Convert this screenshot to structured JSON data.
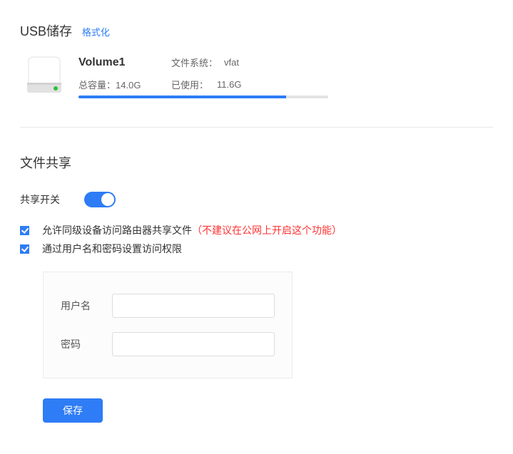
{
  "storage": {
    "title": "USB储存",
    "format_link": "格式化",
    "volume_name": "Volume1",
    "fs_label": "文件系统：",
    "fs_value": "vfat",
    "capacity_label": "总容量：",
    "capacity_value": "14.0G",
    "used_label": "已使用：",
    "used_value": "11.6G",
    "progress_percent": 83
  },
  "share": {
    "title": "文件共享",
    "switch_label": "共享开关",
    "switch_on": true,
    "opt_same_level": "允许同级设备访问路由器共享文件",
    "opt_same_level_warn": "（不建议在公网上开启这个功能）",
    "opt_auth": "通过用户名和密码设置访问权限",
    "username_label": "用户名",
    "username_value": "",
    "password_label": "密码",
    "password_value": "",
    "save_label": "保存"
  }
}
